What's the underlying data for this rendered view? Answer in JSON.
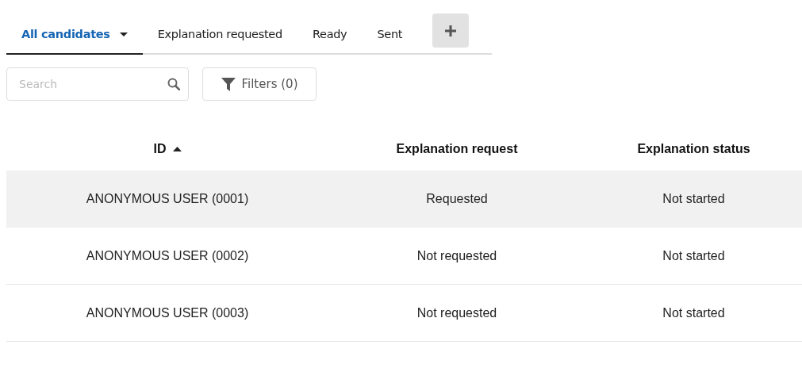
{
  "tabs": [
    {
      "label": "All candidates",
      "selected": true,
      "has_menu": true
    },
    {
      "label": "Explanation requested",
      "selected": false,
      "has_menu": false
    },
    {
      "label": "Ready",
      "selected": false,
      "has_menu": false
    },
    {
      "label": "Sent",
      "selected": false,
      "has_menu": false
    }
  ],
  "search": {
    "placeholder": "Search"
  },
  "filters_button": {
    "label": "Filters (0)"
  },
  "table": {
    "columns": [
      {
        "label": "ID",
        "sorted": true
      },
      {
        "label": "Explanation request",
        "sorted": false
      },
      {
        "label": "Explanation status",
        "sorted": false
      }
    ],
    "rows": [
      {
        "selected": true,
        "cells": [
          "ANONYMOUS USER (0001)",
          "Requested",
          "Not started"
        ]
      },
      {
        "selected": false,
        "cells": [
          "ANONYMOUS USER (0002)",
          "Not requested",
          "Not started"
        ]
      },
      {
        "selected": false,
        "cells": [
          "ANONYMOUS USER (0003)",
          "Not requested",
          "Not started"
        ]
      }
    ]
  }
}
